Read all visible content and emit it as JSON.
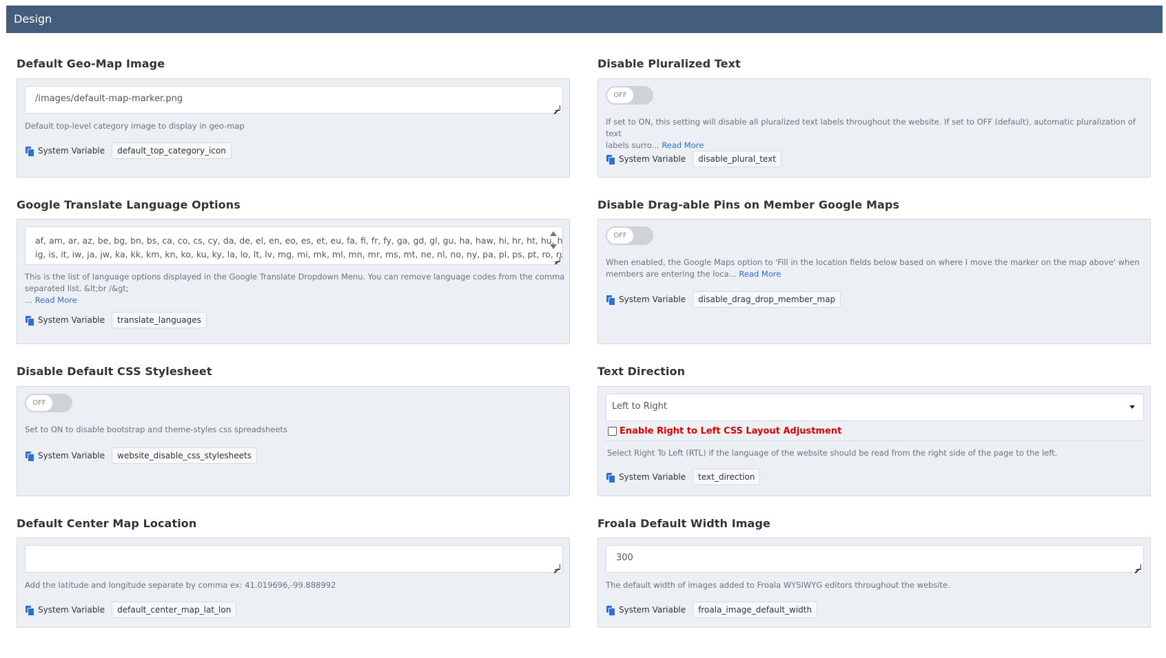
{
  "header": {
    "title": "Design"
  },
  "sysvar_label": "System Variable",
  "read_more": "Read More",
  "left": {
    "geo_map": {
      "title": "Default Geo-Map Image",
      "value": "/images/default-map-marker.png",
      "help": "Default top-level category image to display in geo-map",
      "variable": "default_top_category_icon"
    },
    "translate": {
      "title": "Google Translate Language Options",
      "value_line1": "af, am, ar, az, be, bg, bn, bs, ca, co, cs, cy, da, de, el, en, eo, es, et, eu, fa, fi, fr, fy, ga, gd, gl, gu, ha, haw, hi, hr, ht, hu, hy, id,",
      "value_line2": "ig, is, it, iw, ja, jw, ka, kk, km, kn, ko, ku, ky, la, lo, lt, lv, mg, mi, mk, ml, mn, mr, ms, mt, ne, nl, no, ny, pa, pl, ps, pt, ro, ru, sd, si,",
      "help_line1": "This is the list of language options displayed in the Google Translate Dropdown Menu. You can remove language codes from the comma",
      "help_line2": "separated list. &lt;br /&gt;",
      "help_ellipsis": "...",
      "variable": "translate_languages"
    },
    "css": {
      "title": "Disable Default CSS Stylesheet",
      "toggle": "OFF",
      "help": "Set to ON to disable bootstrap and theme-styles css spreadsheets",
      "variable": "website_disable_css_stylesheets"
    },
    "center_map": {
      "title": "Default Center Map Location",
      "value": "",
      "help": "Add the latitude and longitude separate by comma ex: 41.019696,-99.888992",
      "variable": "default_center_map_lat_lon"
    }
  },
  "right": {
    "plural": {
      "title": "Disable Pluralized Text",
      "toggle": "OFF",
      "help_line1": "If set to ON, this setting will disable all pluralized text labels throughout the website. If set to OFF (default), automatic pluralization of text",
      "help_line2": "labels surro...",
      "variable": "disable_plural_text"
    },
    "drag_pins": {
      "title": "Disable Drag-able Pins on Member Google Maps",
      "toggle": "OFF",
      "help_line1": "When enabled, the Google Maps option to 'Fill in the location fields below based on where I move the marker on the map above' when",
      "help_line2": "members are entering the loca...",
      "variable": "disable_drag_drop_member_map"
    },
    "text_direction": {
      "title": "Text Direction",
      "selected": "Left to Right",
      "checkbox_label": "Enable Right to Left CSS Layout Adjustment",
      "help": "Select Right To Left (RTL) if the language of the website should be read from the right side of the page to the left.",
      "variable": "text_direction"
    },
    "froala": {
      "title": "Froala Default Width Image",
      "value": "300",
      "help": "The default width of images added to Froala WYSIWYG editors throughout the website.",
      "variable": "froala_image_default_width"
    }
  }
}
